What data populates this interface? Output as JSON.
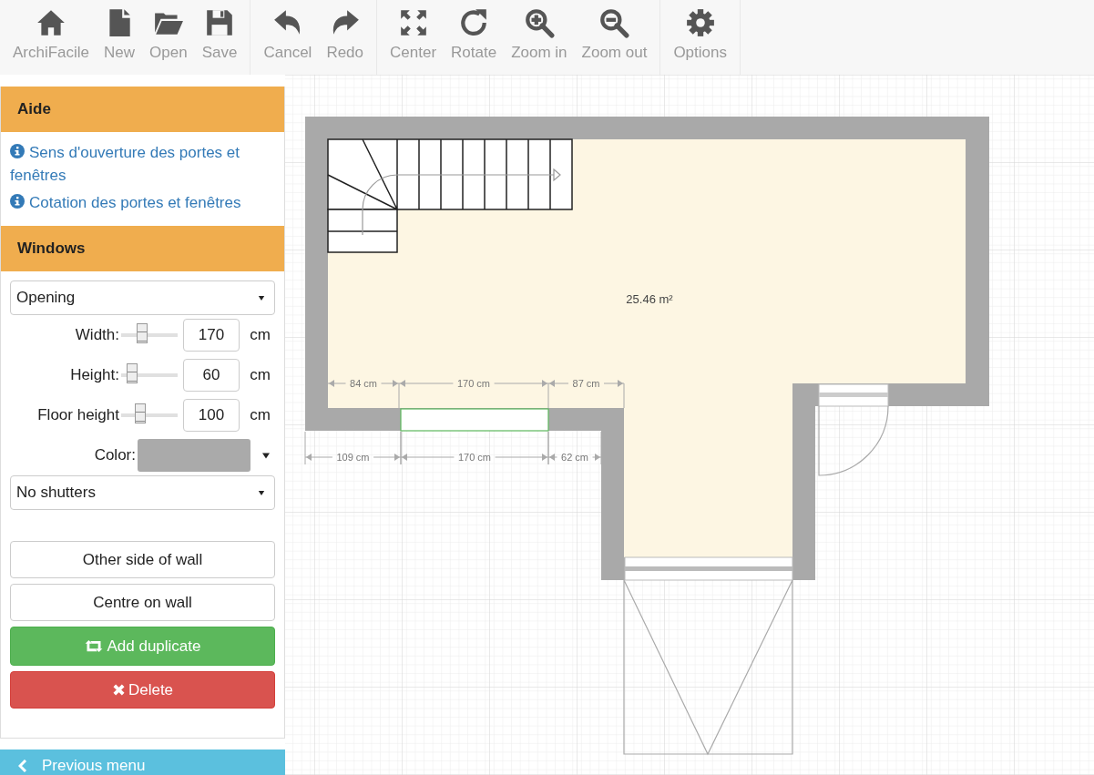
{
  "toolbar": {
    "groups": [
      [
        {
          "kind": "home",
          "label": "ArchiFacile"
        },
        {
          "kind": "new",
          "label": "New"
        },
        {
          "kind": "open",
          "label": "Open"
        },
        {
          "kind": "save",
          "label": "Save"
        }
      ],
      [
        {
          "kind": "undo",
          "label": "Cancel"
        },
        {
          "kind": "redo",
          "label": "Redo"
        }
      ],
      [
        {
          "kind": "center",
          "label": "Center"
        },
        {
          "kind": "rotate",
          "label": "Rotate"
        },
        {
          "kind": "zoomin",
          "label": "Zoom in"
        },
        {
          "kind": "zoomout",
          "label": "Zoom out"
        }
      ],
      [
        {
          "kind": "options",
          "label": "Options"
        }
      ]
    ]
  },
  "help": {
    "title": "Aide",
    "links": [
      "Sens d'ouverture des portes et fenêtres",
      "Cotation des portes et fenêtres"
    ]
  },
  "windows": {
    "title": "Windows",
    "type_select": {
      "value": "Opening"
    },
    "sliders": [
      {
        "label": "Width:",
        "level": 0.33,
        "value": "170",
        "unit": "cm"
      },
      {
        "label": "Height:",
        "level": 0.12,
        "value": "60",
        "unit": "cm"
      },
      {
        "label": "Floor height",
        "level": 0.3,
        "value": "100",
        "unit": "cm"
      }
    ],
    "color": {
      "label": "Color:",
      "color": "#aaaaaa"
    },
    "shutters_select": {
      "value": "No shutters"
    },
    "buttons": [
      {
        "kind": "plain",
        "label": "Other side of wall"
      },
      {
        "kind": "plain",
        "label": "Centre on wall"
      },
      {
        "kind": "duplicate",
        "label": "Add duplicate"
      },
      {
        "kind": "delete",
        "label": "Delete"
      }
    ]
  },
  "previous_menu": {
    "label": "Previous menu"
  },
  "plan": {
    "area": "25.46 m²",
    "window_selected": true,
    "dimensions_inside": [
      "84 cm",
      "170 cm",
      "87 cm"
    ],
    "dimensions_outside": [
      "109 cm",
      "170 cm",
      "62 cm"
    ]
  }
}
